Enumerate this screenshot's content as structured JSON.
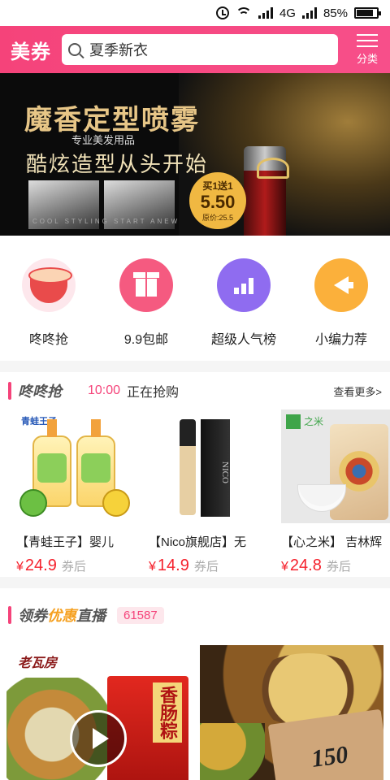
{
  "status_bar": {
    "network": "4G",
    "battery": "85%",
    "battery_level": 0.85
  },
  "header": {
    "brand": "美券",
    "search_value": "夏季新衣",
    "category_label": "分类"
  },
  "banner": {
    "title": "魔香定型喷雾",
    "subtitle": "专业美发用品",
    "slogan": "酷炫造型从头开始",
    "small_text": "COOL STYLING START ANEW",
    "promo_line": "买1送1",
    "promo_price": "5.50",
    "promo_original": "原价:25.5"
  },
  "quick_links": [
    {
      "label": "咚咚抢",
      "icon": "drum-icon"
    },
    {
      "label": "9.9包邮",
      "icon": "gift-icon"
    },
    {
      "label": "超级人气榜",
      "icon": "chart-icon"
    },
    {
      "label": "小编力荐",
      "icon": "megaphone-icon"
    }
  ],
  "flash_sale": {
    "title": "咚咚抢",
    "time": "10:00",
    "status": "正在抢购",
    "more_label": "查看更多>",
    "products": [
      {
        "name": "【青蛙王子】婴儿",
        "currency": "¥",
        "price": "24.9",
        "suffix": "券后",
        "image_brand": "青蛙王子"
      },
      {
        "name": "【Nico旗舰店】无",
        "currency": "¥",
        "price": "14.9",
        "suffix": "券后",
        "image_brand": "NICO"
      },
      {
        "name": "【心之米】 吉林辉",
        "currency": "¥",
        "price": "24.8",
        "suffix": "券后",
        "image_brand": "之米"
      }
    ]
  },
  "live": {
    "title_part1": "领券",
    "title_highlight": "优惠",
    "title_part2": "直播",
    "count": "61587",
    "tiles": [
      {
        "logo": "老瓦房",
        "pack_text": "香肠粽"
      },
      {
        "title": "",
        "card_text": "150"
      }
    ]
  },
  "colors": {
    "accent": "#f5437a",
    "price": "#f5222d",
    "highlight": "#f5a020"
  }
}
